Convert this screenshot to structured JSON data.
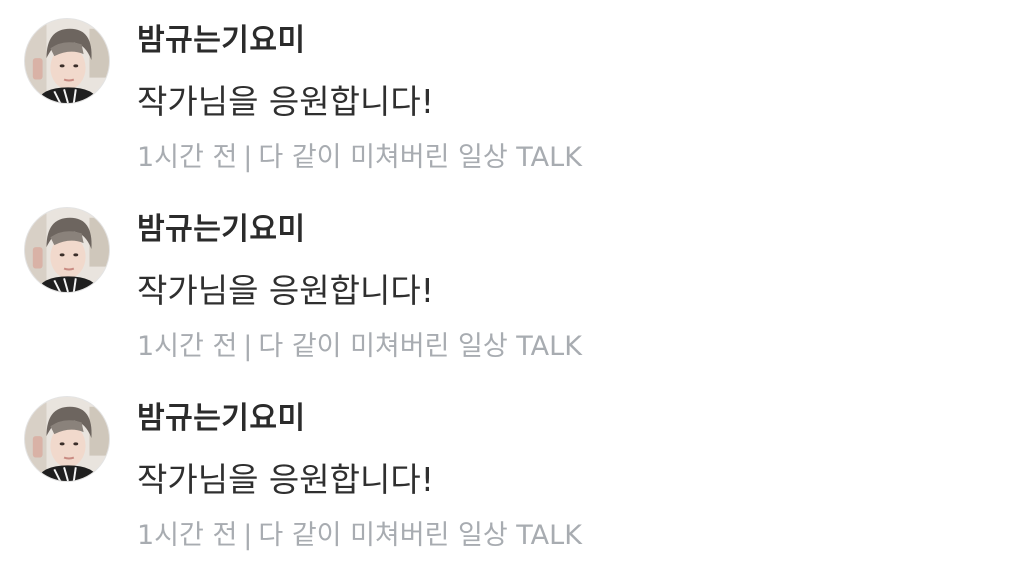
{
  "comments": [
    {
      "author": "밤규는기요미",
      "text": "작가님을 응원합니다!",
      "time": "1시간 전",
      "separator": "|",
      "source": "다 같이 미쳐버린 일상 TALK"
    },
    {
      "author": "밤규는기요미",
      "text": "작가님을 응원합니다!",
      "time": "1시간 전",
      "separator": "|",
      "source": "다 같이 미쳐버린 일상 TALK"
    },
    {
      "author": "밤규는기요미",
      "text": "작가님을 응원합니다!",
      "time": "1시간 전",
      "separator": "|",
      "source": "다 같이 미쳐버린 일상 TALK"
    }
  ],
  "colors": {
    "author": "#2b2b2b",
    "text": "#2f2f2f",
    "meta": "#a8acb1",
    "background": "#ffffff"
  },
  "icons": {
    "avatar": "user-photo-avatar"
  }
}
